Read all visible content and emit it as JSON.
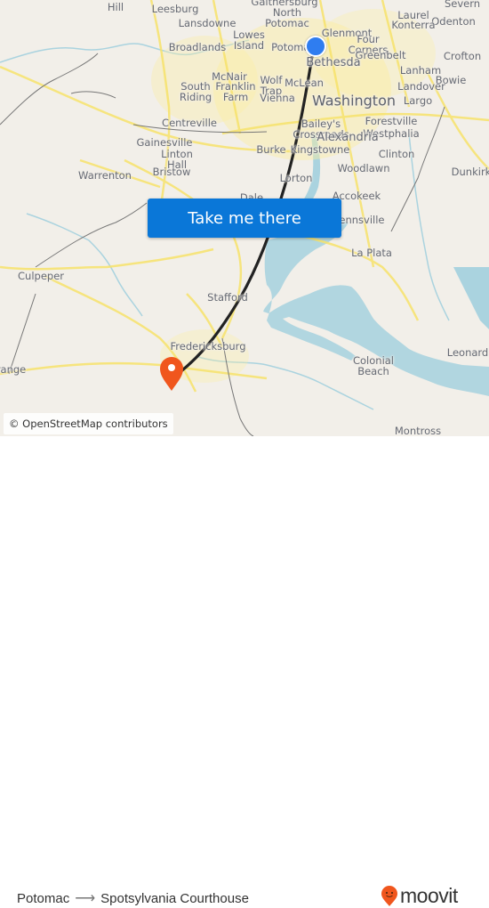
{
  "map": {
    "places": [
      {
        "name": "Hill",
        "size": "normal"
      },
      {
        "name": "Leesburg",
        "size": "normal"
      },
      {
        "name": "Lansdowne",
        "size": "normal"
      },
      {
        "name": "Gaithersburg",
        "size": "normal"
      },
      {
        "name": "North\nPotomac",
        "size": "normal"
      },
      {
        "name": "Laurel",
        "size": "normal"
      },
      {
        "name": "Severn",
        "size": "normal"
      },
      {
        "name": "Odenton",
        "size": "normal"
      },
      {
        "name": "Konterra",
        "size": "normal"
      },
      {
        "name": "Glenmont",
        "size": "normal"
      },
      {
        "name": "Four\nCorners",
        "size": "normal"
      },
      {
        "name": "Greenbelt",
        "size": "normal"
      },
      {
        "name": "Crofton",
        "size": "normal"
      },
      {
        "name": "Lowes\nIsland",
        "size": "normal"
      },
      {
        "name": "Broadlands",
        "size": "normal"
      },
      {
        "name": "Potomac",
        "size": "normal"
      },
      {
        "name": "Bethesda",
        "size": "mid"
      },
      {
        "name": "McNair",
        "size": "normal"
      },
      {
        "name": "South\nRiding",
        "size": "normal"
      },
      {
        "name": "Franklin\nFarm",
        "size": "normal"
      },
      {
        "name": "Wolf\nTrap",
        "size": "normal"
      },
      {
        "name": "Vienna",
        "size": "normal"
      },
      {
        "name": "McLean",
        "size": "normal"
      },
      {
        "name": "Lanham",
        "size": "normal"
      },
      {
        "name": "Bowie",
        "size": "normal"
      },
      {
        "name": "Landover",
        "size": "normal"
      },
      {
        "name": "Washington",
        "size": "big"
      },
      {
        "name": "Largo",
        "size": "normal"
      },
      {
        "name": "Centreville",
        "size": "normal"
      },
      {
        "name": "Bailey's\nCrossroads",
        "size": "normal"
      },
      {
        "name": "Forestville",
        "size": "normal"
      },
      {
        "name": "Westphalia",
        "size": "normal"
      },
      {
        "name": "Alexandria",
        "size": "mid"
      },
      {
        "name": "Gainesville",
        "size": "normal"
      },
      {
        "name": "Linton\nHall",
        "size": "normal"
      },
      {
        "name": "Burke",
        "size": "normal"
      },
      {
        "name": "Kingstowne",
        "size": "normal"
      },
      {
        "name": "Clinton",
        "size": "normal"
      },
      {
        "name": "Bristow",
        "size": "normal"
      },
      {
        "name": "Warrenton",
        "size": "normal"
      },
      {
        "name": "Woodlawn",
        "size": "normal"
      },
      {
        "name": "Dunkirk",
        "size": "normal"
      },
      {
        "name": "Lorton",
        "size": "normal"
      },
      {
        "name": "Accokeek",
        "size": "normal"
      },
      {
        "name": "Bennsville",
        "size": "normal"
      },
      {
        "name": "La Plata",
        "size": "normal"
      },
      {
        "name": "Culpeper",
        "size": "normal"
      },
      {
        "name": "Stafford",
        "size": "normal"
      },
      {
        "name": "Fredericksburg",
        "size": "normal"
      },
      {
        "name": "Leonard",
        "size": "normal"
      },
      {
        "name": "Colonial\nBeach",
        "size": "normal"
      },
      {
        "name": "Orange",
        "size": "normal"
      },
      {
        "name": "Montross",
        "size": "normal"
      },
      {
        "name": "Dale",
        "size": "normal"
      }
    ],
    "origin_marker": {
      "label": "Potomac",
      "color": "#2f7df0"
    },
    "destination_marker": {
      "label": "Spotsylvania Courthouse",
      "color": "#f0561d"
    },
    "route_color": "#222222",
    "attribution": "© OpenStreetMap contributors"
  },
  "cta": {
    "label": "Take me there",
    "color": "#0a77d8"
  },
  "footer": {
    "origin": "Potomac",
    "arrow": "⟶",
    "destination": "Spotsylvania Courthouse",
    "brand": "moovit",
    "brand_color": "#f0561d"
  }
}
